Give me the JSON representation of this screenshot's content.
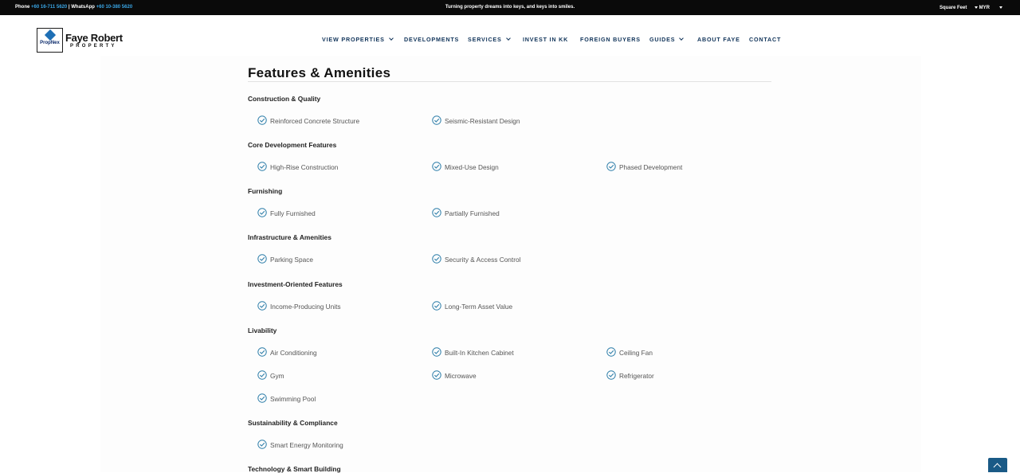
{
  "topbar": {
    "phone_label": "Phone",
    "phone_number": "+60 16-711 5620",
    "separator": "|",
    "whatsapp_label": "WhatsApp",
    "whatsapp_number": "+60 10-380 5620",
    "tagline": "Turning property dreams into keys, and keys into smiles.",
    "unit_selected": "Square Feet",
    "currency_selected": "MYR"
  },
  "brand": {
    "logo_mark_text": "PropNex",
    "name": "Faye Robert",
    "subtitle": "PROPERTY"
  },
  "nav": [
    {
      "label": "VIEW PROPERTIES",
      "has_dropdown": true
    },
    {
      "label": "DEVELOPMENTS",
      "has_dropdown": false
    },
    {
      "label": "SERVICES",
      "has_dropdown": true
    },
    {
      "label": "INVEST IN KK",
      "has_dropdown": false
    },
    {
      "label": "FOREIGN BUYERS",
      "has_dropdown": false
    },
    {
      "label": "GUIDES",
      "has_dropdown": true
    },
    {
      "label": "ABOUT FAYE",
      "has_dropdown": false
    },
    {
      "label": "CONTACT",
      "has_dropdown": false
    }
  ],
  "section": {
    "title": "Features & Amenities",
    "categories": [
      {
        "name": "Construction & Quality",
        "items": [
          "Reinforced Concrete Structure",
          "Seismic-Resistant Design"
        ]
      },
      {
        "name": "Core Development Features",
        "items": [
          "High-Rise Construction",
          "Mixed-Use Design",
          "Phased Development"
        ]
      },
      {
        "name": "Furnishing",
        "items": [
          "Fully Furnished",
          "Partially Furnished"
        ]
      },
      {
        "name": "Infrastructure & Amenities",
        "items": [
          "Parking Space",
          "Security & Access Control"
        ]
      },
      {
        "name": "Investment-Oriented Features",
        "items": [
          "Income-Producing Units",
          "Long-Term Asset Value"
        ]
      },
      {
        "name": "Livability",
        "items": [
          "Air Conditioning",
          "Built-In Kitchen Cabinet",
          "Ceiling Fan",
          "Gym",
          "Microwave",
          "Refrigerator",
          "Swimming Pool"
        ]
      },
      {
        "name": "Sustainability & Compliance",
        "items": [
          "Smart Energy Monitoring"
        ]
      },
      {
        "name": "Technology & Smart Building",
        "items": []
      }
    ]
  },
  "colors": {
    "topbar_bg": "#0a0a0a",
    "link_blue": "#3aa6e6",
    "nav_text": "#11345a",
    "check_icon": "#2f7faa",
    "back_to_top_bg": "#1a5a86"
  },
  "icons": {
    "feature": "check-circle-icon",
    "back_to_top": "chevron-up-icon"
  }
}
